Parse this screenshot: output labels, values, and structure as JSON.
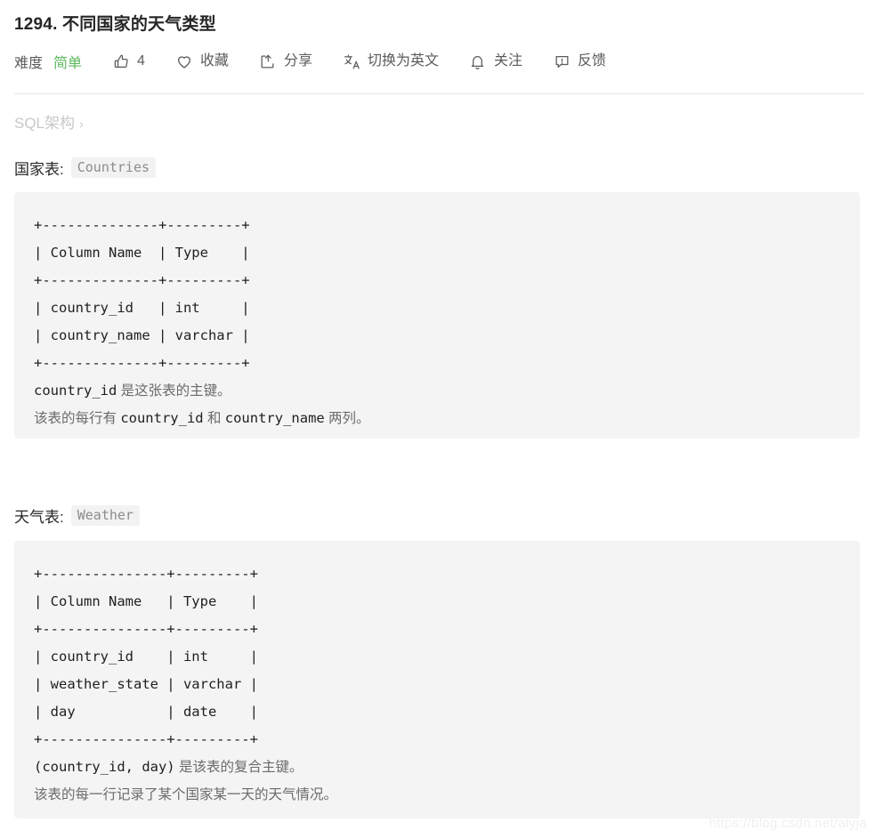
{
  "problem": {
    "title": "1294. 不同国家的天气类型"
  },
  "toolbar": {
    "difficulty_label": "难度",
    "difficulty_value": "简单",
    "difficulty_color": "#5cb85c",
    "like_count": "4",
    "like_icon": "thumbs-up-icon",
    "favorite_label": "收藏",
    "favorite_icon": "heart-icon",
    "share_label": "分享",
    "share_icon": "share-icon",
    "translate_label": "切换为英文",
    "translate_icon": "translate-icon",
    "follow_label": "关注",
    "follow_icon": "bell-icon",
    "feedback_label": "反馈",
    "feedback_icon": "feedback-icon"
  },
  "breadcrumb": {
    "label": "SQL架构",
    "arrow": "›"
  },
  "sections": [
    {
      "heading_text": "国家表:",
      "heading_code": "Countries",
      "code": "+--------------+---------+\n| Column Name  | Type    |\n+--------------+---------+\n| country_id   | int     |\n| country_name | varchar |\n+--------------+---------+",
      "notes": [
        {
          "code1": "country_id",
          "cn1": " 是这张表的主键。",
          "code2": "",
          "cn2": "",
          "code3": "",
          "cn3": ""
        },
        {
          "code1": "",
          "cn1": "该表的每行有 ",
          "code2": "country_id",
          "cn2": " 和 ",
          "code3": "country_name",
          "cn3": " 两列。"
        }
      ]
    },
    {
      "heading_text": "天气表:",
      "heading_code": "Weather",
      "code": "+---------------+---------+\n| Column Name   | Type    |\n+---------------+---------+\n| country_id    | int     |\n| weather_state | varchar |\n| day           | date    |\n+---------------+---------+",
      "notes": [
        {
          "code1": "(country_id, day)",
          "cn1": " 是该表的复合主键。",
          "code2": "",
          "cn2": "",
          "code3": "",
          "cn3": ""
        },
        {
          "code1": "",
          "cn1": "该表的每一行记录了某个国家某一天的天气情况。",
          "code2": "",
          "cn2": "",
          "code3": "",
          "cn3": ""
        }
      ]
    }
  ],
  "watermark": {
    "text": "https://blog.csdn.net/alyja"
  }
}
